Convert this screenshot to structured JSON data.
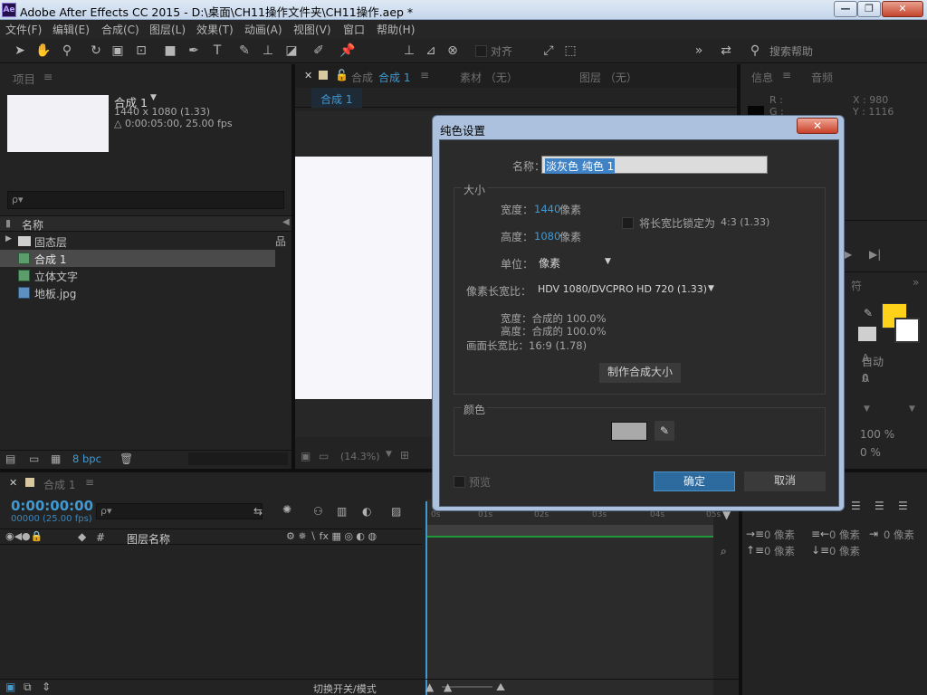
{
  "app": {
    "logo_text": "Ae",
    "title": "Adobe After Effects CC 2015 - D:\\桌面\\CH11操作文件夹\\CH11操作.aep *",
    "window_buttons": {
      "minimize": "—",
      "restore": "❐",
      "close": "✕"
    }
  },
  "menu": [
    "文件(F)",
    "编辑(E)",
    "合成(C)",
    "图层(L)",
    "效果(T)",
    "动画(A)",
    "视图(V)",
    "窗口",
    "帮助(H)"
  ],
  "toolbar": {
    "align_label": "对齐",
    "search_placeholder": "搜索帮助"
  },
  "project": {
    "tab": "项目",
    "comp_name": "合成 1",
    "comp_size": "1440 x 1080 (1.33)",
    "comp_duration": "△ 0:00:05:00, 25.00 fps",
    "search_icon": "ρ▾",
    "col_name": "名称",
    "items": [
      {
        "name": "固态层",
        "type": "folder"
      },
      {
        "name": "合成 1",
        "type": "comp"
      },
      {
        "name": "立体文字",
        "type": "comp"
      },
      {
        "name": "地板.jpg",
        "type": "image"
      }
    ],
    "bpc": "8 bpc"
  },
  "comp_viewer": {
    "tab_prefix": "合成",
    "tab_name": "合成 1",
    "footage_tab": "素材 （无）",
    "layer_tab": "图层 （无）",
    "breadcrumb": "合成 1",
    "zoom": "(14.3%)"
  },
  "info": {
    "tab": "信息",
    "audio_tab": "音频",
    "r_label": "R :",
    "g_label": "G :",
    "x_label": "X : 980",
    "y_label": "Y : 1116"
  },
  "character": {
    "tab_fragment": "符",
    "auto": "自动",
    "zero": "0",
    "percent1": "100 %",
    "percent2": "0 %",
    "fill_color": "#ffd21a"
  },
  "paragraph": {
    "r1": [
      "0 像素",
      "0 像素",
      "0 像素"
    ],
    "r2": [
      "0 像素",
      "0 像素"
    ]
  },
  "timeline": {
    "comp_tab": "合成 1",
    "timecode": "0:00:00:00",
    "frame_info": "00000 (25.00 fps)",
    "col_hash": "#",
    "col_layer_name": "图层名称",
    "ruler": [
      "0s",
      "01s",
      "02s",
      "03s",
      "04s",
      "05s"
    ],
    "toggle_label": "切换开关/模式"
  },
  "dialog": {
    "title": "纯色设置",
    "name_label": "名称：",
    "name_value": "淡灰色 纯色 1",
    "size_group": "大小",
    "width_label": "宽度：",
    "width_value": "1440",
    "height_label": "高度：",
    "height_value": "1080",
    "unit_px": "像素",
    "lock_label": "将长宽比锁定为",
    "lock_value": "4:3 (1.33)",
    "units_label": "单位：",
    "units_value": "像素",
    "par_label": "像素长宽比：",
    "par_value": "HDV 1080/DVCPRO HD 720 (1.33)",
    "rel_width": "宽度：合成的  100.0%",
    "rel_height": "高度：合成的  100.0%",
    "frame_aspect": "画面长宽比：16:9 (1.78)",
    "make_comp_size": "制作合成大小",
    "color_group": "颜色",
    "color_value": "#a9a9a9",
    "preview": "预览",
    "ok": "确定",
    "cancel": "取消"
  }
}
